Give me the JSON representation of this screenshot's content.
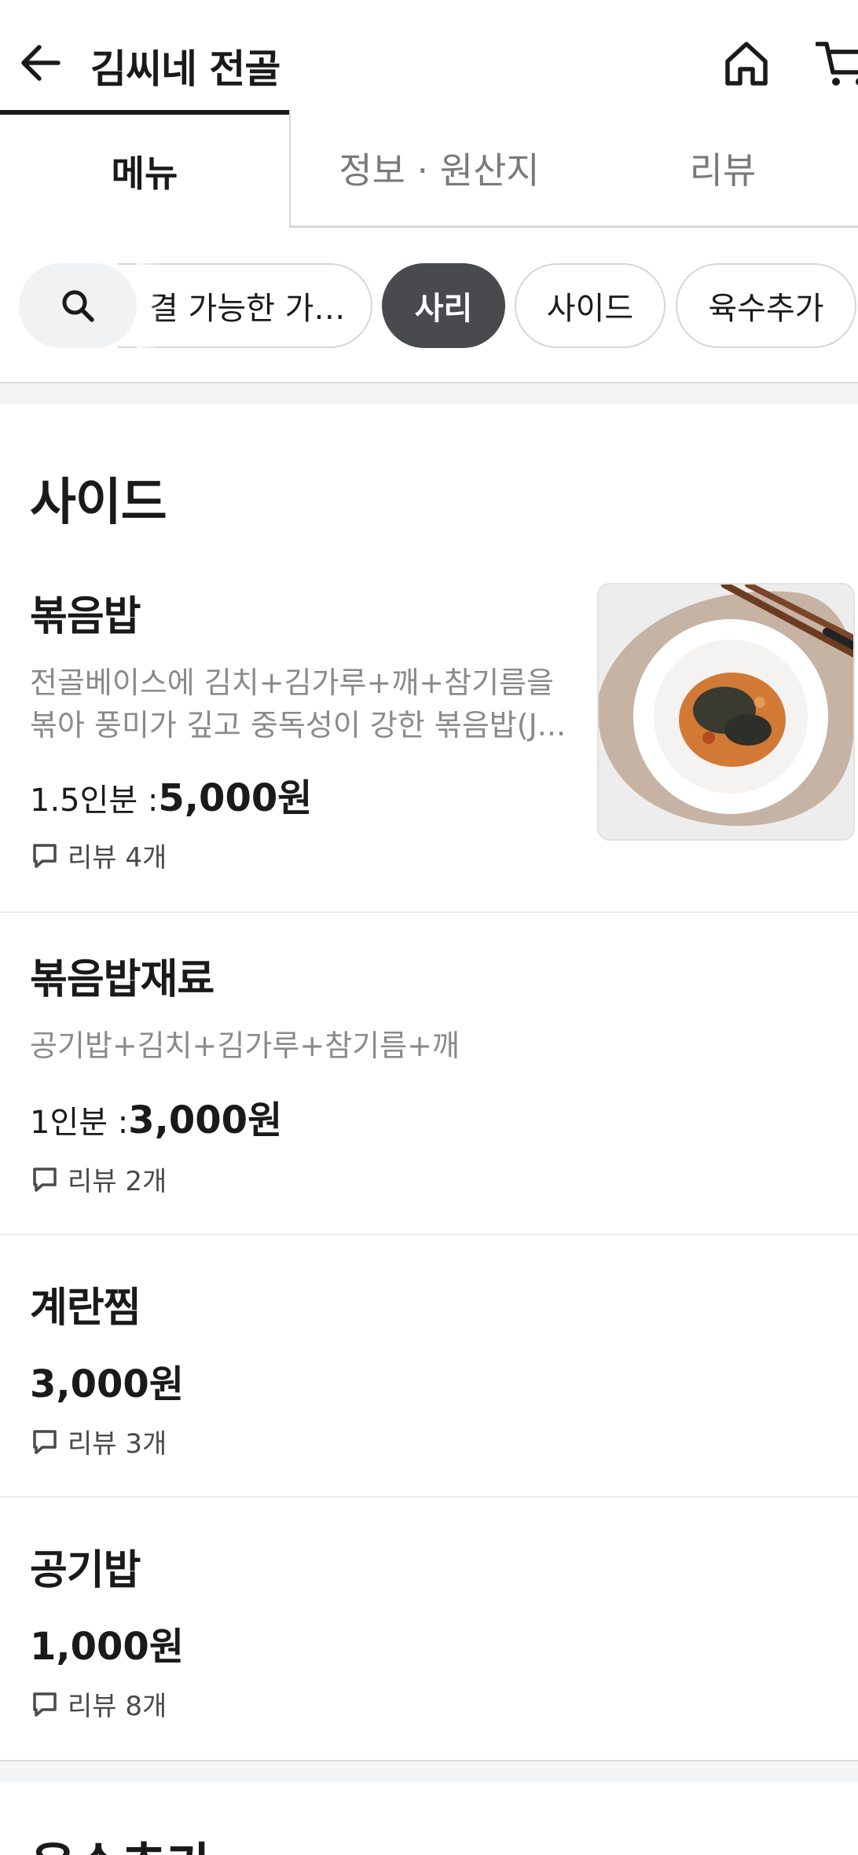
{
  "header": {
    "title": "김씨네 전골",
    "back_icon": "arrow-left-icon",
    "home_icon": "home-icon",
    "cart_icon": "cart-icon"
  },
  "tabs": [
    {
      "label": "메뉴",
      "active": true
    },
    {
      "label": "정보 · 원산지",
      "active": false
    },
    {
      "label": "리뷰",
      "active": false
    }
  ],
  "filters": {
    "search_icon": "search-icon",
    "chips": [
      {
        "label": "결 가능한 가…",
        "active": false
      },
      {
        "label": "사리",
        "active": true
      },
      {
        "label": "사이드",
        "active": false
      },
      {
        "label": "육수추가",
        "active": false
      }
    ]
  },
  "section": {
    "title": "사이드",
    "items": [
      {
        "name": "볶음밥",
        "description": "전골베이스에 김치+김가루+깨+참기름을 볶아 풍미가 깊고 중독성이 강한 볶음밥(J...",
        "portion": "1.5인분 : ",
        "price": "5,000원",
        "review": "리뷰 4개",
        "has_photo": true
      },
      {
        "name": "볶음밥재료",
        "description": "공기밥+김치+김가루+참기름+깨",
        "portion": "1인분 : ",
        "price": "3,000원",
        "review": "리뷰 2개"
      },
      {
        "name": "계란찜",
        "price": "3,000원",
        "review": "리뷰 3개"
      },
      {
        "name": "공기밥",
        "price": "1,000원",
        "review": "리뷰 8개"
      }
    ]
  },
  "next_section": {
    "title": "육수추가"
  },
  "colors": {
    "active_chip": "#484a4d",
    "text_primary": "#1a1a1a",
    "text_secondary": "#8a8a8a"
  }
}
